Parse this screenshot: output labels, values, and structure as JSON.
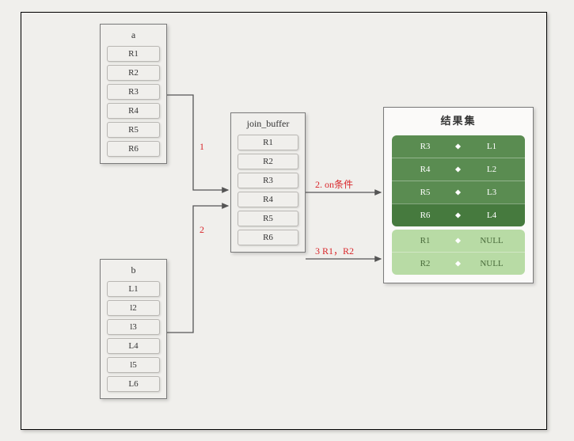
{
  "boxes": {
    "a": {
      "title": "a",
      "rows": [
        "R1",
        "R2",
        "R3",
        "R4",
        "R5",
        "R6"
      ]
    },
    "b": {
      "title": "b",
      "rows": [
        "L1",
        "l2",
        "l3",
        "L4",
        "l5",
        "L6"
      ]
    },
    "buffer": {
      "title": "join_buffer",
      "rows": [
        "R1",
        "R2",
        "R3",
        "R4",
        "R5",
        "R6"
      ]
    }
  },
  "result": {
    "title": "结果集",
    "matched": [
      {
        "left": "R3",
        "right": "L1"
      },
      {
        "left": "R4",
        "right": "L2"
      },
      {
        "left": "R5",
        "right": "L3"
      },
      {
        "left": "R6",
        "right": "L4"
      }
    ],
    "unmatched": [
      {
        "left": "R1",
        "right": "NULL"
      },
      {
        "left": "R2",
        "right": "NULL"
      }
    ]
  },
  "labels": {
    "step1": "1",
    "step2": "2",
    "on_cond": "2. on条件",
    "null_fill": "3 R1，R2"
  }
}
